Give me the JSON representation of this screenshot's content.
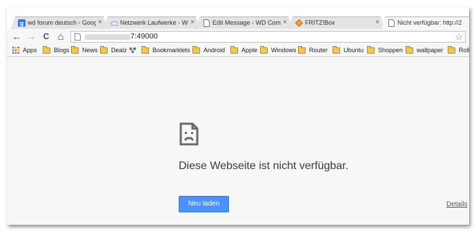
{
  "tabs": [
    {
      "title": "wd forum deutsch - Goog",
      "favicon": "google-icon",
      "close": "×"
    },
    {
      "title": "Netzwerk Laufwerke - WD",
      "favicon": "cloud-icon",
      "close": "×"
    },
    {
      "title": "Edit Message - WD Comm",
      "favicon": "page-icon",
      "close": "×"
    },
    {
      "title": "FRITZ!Box",
      "favicon": "fritzbox-icon",
      "close": "×"
    },
    {
      "title": "Nicht verfügbar: http://2",
      "favicon": "page-icon",
      "close": "×",
      "active": true
    }
  ],
  "toolbar": {
    "back": "←",
    "forward": "→",
    "reload": "C",
    "home": "⌂",
    "url_suffix": "7:49000",
    "star": "☆"
  },
  "bookmarks": [
    "Apps",
    "Blogs",
    "News",
    "Dealz",
    "Bookmarklets",
    "Android",
    "Apple",
    "Windows",
    "Router",
    "Ubuntu",
    "Shoppen",
    "wallpaper",
    "Rolle"
  ],
  "error": {
    "message": "Diese Webseite ist nicht verfügbar.",
    "reload_button": "Neu laden",
    "details_link": "Details"
  }
}
